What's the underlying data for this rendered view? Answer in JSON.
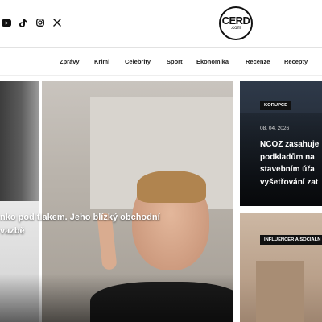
{
  "header": {
    "logo_line1": "CERD",
    "logo_line2": ".com",
    "socials": [
      "youtube-icon",
      "tiktok-icon",
      "instagram-icon",
      "x-icon"
    ]
  },
  "nav": {
    "items": [
      "Zprávy",
      "Krimi",
      "Celebrity",
      "Sport",
      "Ekonomika",
      "Recenze",
      "Recepty"
    ]
  },
  "main_article": {
    "title_line1": "nko pod tlakem. Jeho blízký obchodní",
    "title_line2": "vazbě"
  },
  "side_articles": [
    {
      "badge": "KORUPCE",
      "date": "08. 04. 2026",
      "title_lines": [
        "NCOZ zasahuje",
        "podkladům na",
        "stavebním úřa",
        "vyšetřování zat"
      ]
    },
    {
      "badge": "INFLUENCER A SOCIÁLN"
    }
  ]
}
